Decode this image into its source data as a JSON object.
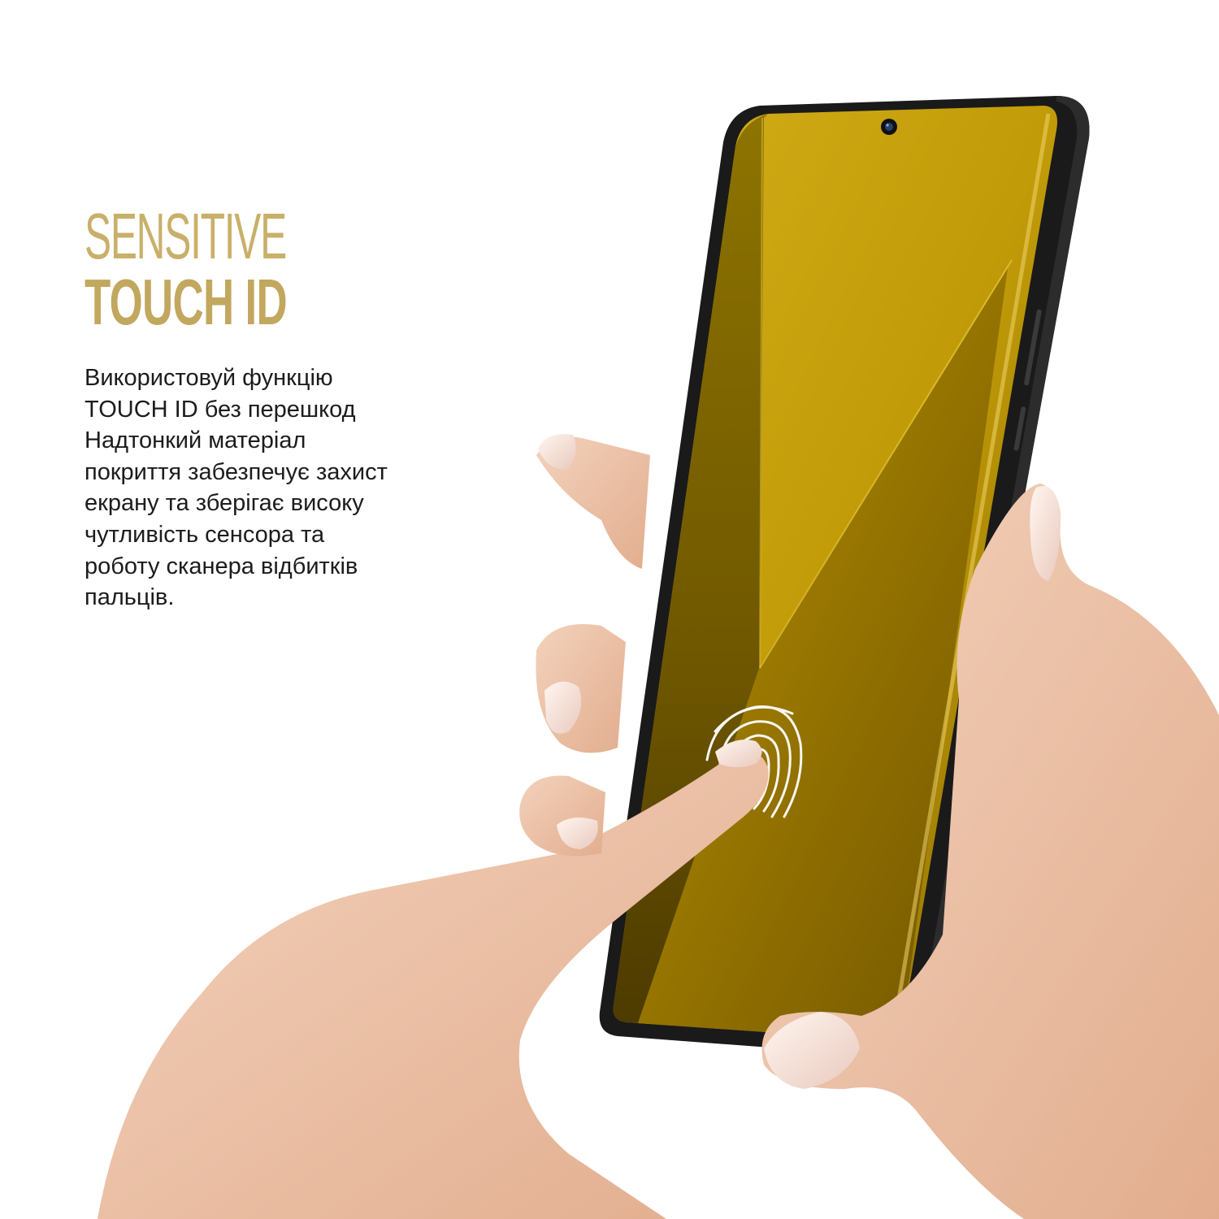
{
  "headline": {
    "line1": "SENSITIVE",
    "line2": "TOUCH ID"
  },
  "description": {
    "lines": [
      "Використовуй функцію",
      "TOUCH ID без перешкод",
      "Надтонкий матеріал",
      "покриття забезпечує захист",
      "екрану та зберігає високу",
      "чутливість сенсора та",
      "роботу сканера відбитків",
      "пальців."
    ]
  },
  "colors": {
    "accent_gold": "#c9b06a",
    "screen_yellow": "#c9a300",
    "phone_frame": "#1a1a1a",
    "skin": "#eec5aa",
    "text_dark": "#1c1c1c"
  },
  "icons": {
    "fingerprint": "fingerprint-icon",
    "camera": "front-camera-icon"
  }
}
